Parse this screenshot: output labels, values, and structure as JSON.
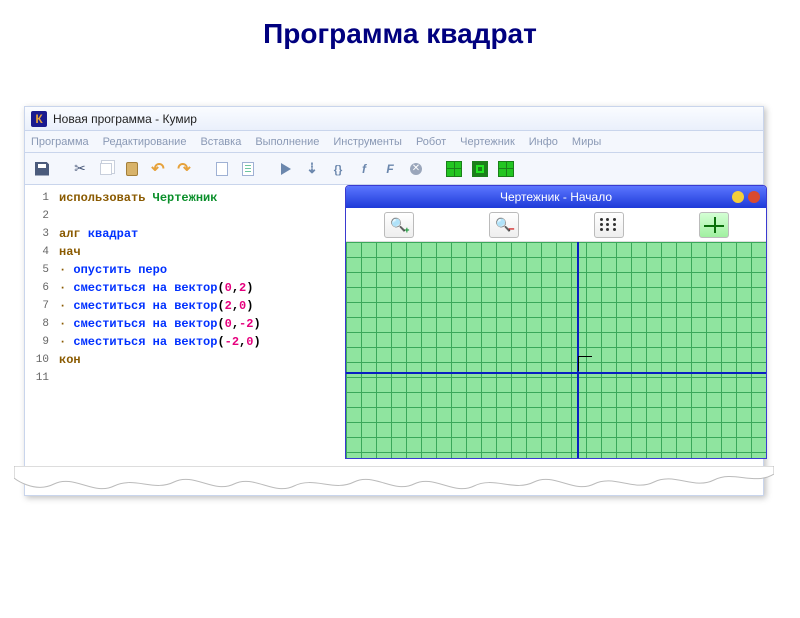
{
  "slide": {
    "title": "Программа квадрат"
  },
  "window": {
    "title": "Новая программа - Кумир",
    "icon_letter": "К"
  },
  "menu": {
    "items": [
      "Программа",
      "Редактирование",
      "Вставка",
      "Выполнение",
      "Инструменты",
      "Робот",
      "Чертежник",
      "Инфо",
      "Миры"
    ]
  },
  "code": {
    "line_numbers": [
      "1",
      "2",
      "3",
      "4",
      "5",
      "6",
      "7",
      "8",
      "9",
      "10",
      "11"
    ],
    "kw_use": "использовать",
    "lib": "Чертежник",
    "kw_alg": "алг",
    "name": "квадрат",
    "kw_begin": "нач",
    "cmd_pen": "опустить перо",
    "cmd_move": "сместиться на вектор",
    "args": [
      "(0,2)",
      "(2,0)",
      "(0,-2)",
      "(-2,0)"
    ],
    "kw_end": "кон"
  },
  "drawer": {
    "title": "Чертежник - Начало"
  }
}
